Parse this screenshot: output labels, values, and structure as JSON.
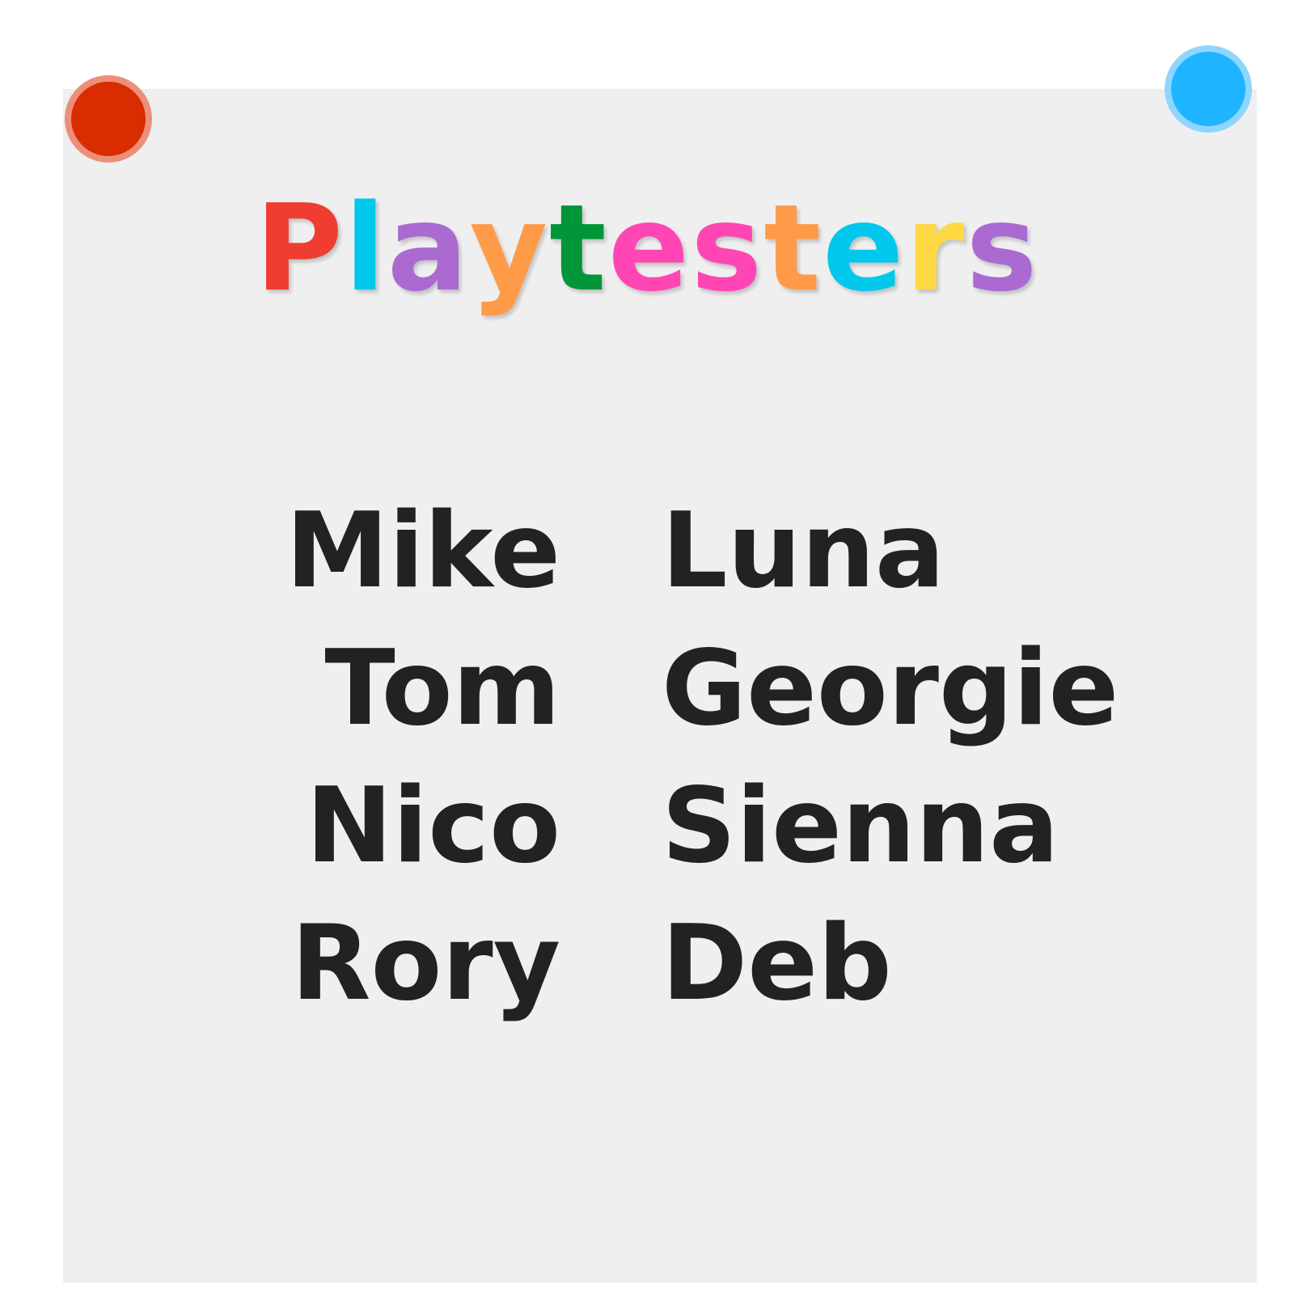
{
  "title": {
    "letters": [
      {
        "char": "P",
        "color": "#ef3d32"
      },
      {
        "char": "l",
        "color": "#00c8ec"
      },
      {
        "char": "a",
        "color": "#aa6ad2"
      },
      {
        "char": "y",
        "color": "#ff9a48"
      },
      {
        "char": "t",
        "color": "#009639"
      },
      {
        "char": "e",
        "color": "#ff46b4"
      },
      {
        "char": "s",
        "color": "#ff46b4"
      },
      {
        "char": "t",
        "color": "#ff9a48"
      },
      {
        "char": "e",
        "color": "#00c8ec"
      },
      {
        "char": "r",
        "color": "#ffd944"
      },
      {
        "char": "s",
        "color": "#aa6ad2"
      }
    ]
  },
  "names": {
    "left": [
      "Mike",
      "Tom",
      "Nico",
      "Rory"
    ],
    "right": [
      "Luna",
      "Georgie",
      "Sienna",
      "Deb"
    ]
  },
  "colors": {
    "sheet": "#efefef",
    "text": "#222222",
    "pin_red": "#d92c00",
    "pin_red_ring": "#ec8f7a",
    "pin_blue": "#1fb4ff",
    "pin_blue_ring": "#8fd6ff"
  },
  "pins": [
    "red-pin",
    "blue-pin"
  ]
}
